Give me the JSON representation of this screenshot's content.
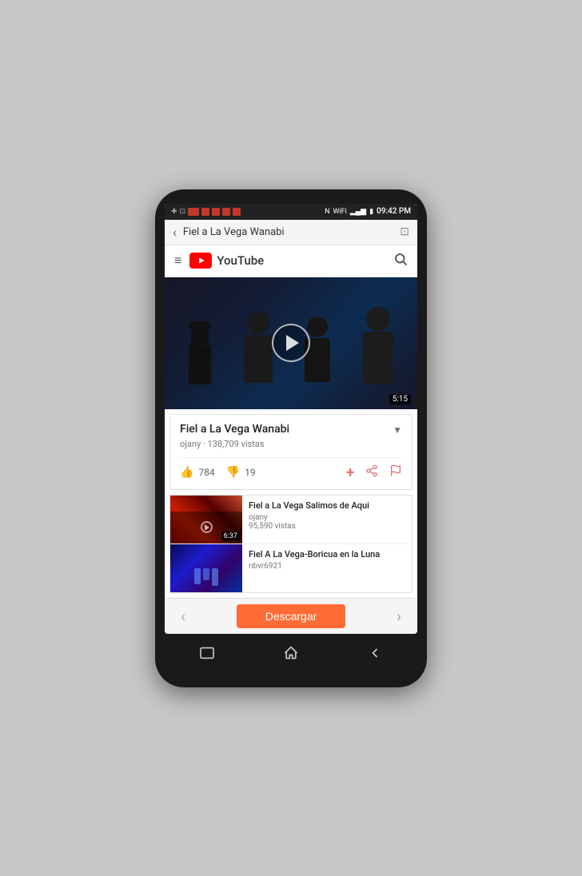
{
  "statusBar": {
    "time": "09:42 PM",
    "icons": [
      "notification",
      "screenshot",
      "red1",
      "red2",
      "red3",
      "red4",
      "red5",
      "nfc",
      "wifi",
      "signal",
      "battery"
    ]
  },
  "browserBar": {
    "title": "Fiel a La Vega Wanabi",
    "backLabel": "‹",
    "castIcon": "⊡"
  },
  "youtubeBar": {
    "menuIcon": "≡",
    "logoText": "YouTube",
    "searchIcon": "🔍"
  },
  "videoPlayer": {
    "duration": "5:15",
    "playButtonAriaLabel": "Play video"
  },
  "videoInfo": {
    "title": "Fiel a La Vega Wanabi",
    "channel": "ojany",
    "views": "138,709 vistas",
    "likes": "784",
    "dislikes": "19",
    "dropdownArrow": "▼"
  },
  "videoActions": {
    "thumbUpIcon": "👍",
    "thumbDownIcon": "👎",
    "addIcon": "+",
    "shareIcon": "⮕",
    "flagIcon": "⚑"
  },
  "relatedVideos": [
    {
      "title": "Fiel a La Vega Salimos de Aqui",
      "channel": "ojany",
      "views": "95,590 vistas",
      "duration": "6:37",
      "thumbType": "red"
    },
    {
      "title": "Fiel A La Vega-Boricua en la Luna",
      "channel": "nbvr6921",
      "views": "",
      "duration": "",
      "thumbType": "blue"
    }
  ],
  "bottomBar": {
    "backLabel": "‹",
    "downloadLabel": "Descargar",
    "forwardLabel": "›"
  },
  "phoneNav": {
    "recentAppsIcon": "▭",
    "homeIcon": "△",
    "backIcon": "↩"
  }
}
